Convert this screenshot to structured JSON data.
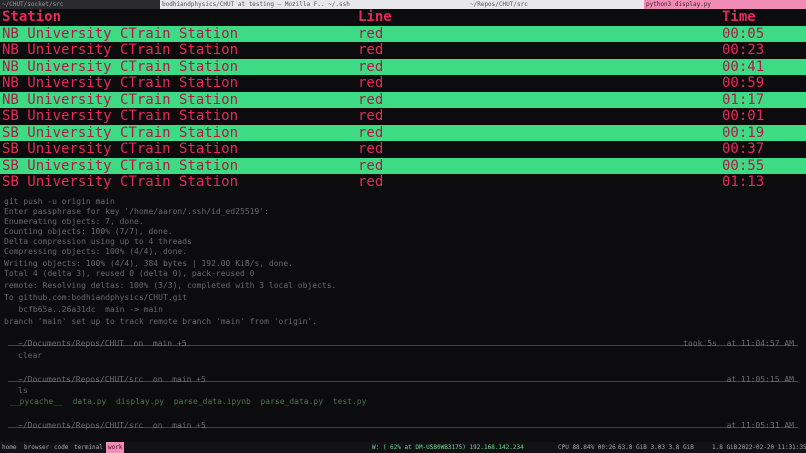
{
  "window_tabs": [
    {
      "label": "~/CHUT/socket/src"
    },
    {
      "label": "bodhiandphysics/CHUT at testing — Mozilla F..  ~/.ssh"
    },
    {
      "label": "~/Repos/CHUT/src"
    },
    {
      "label": "python3 display.py"
    }
  ],
  "terminal_bg": {
    "line1": "Enter passphrase for key '/home/aaron/.ssh/id_ed25519':",
    "line2": "Enumerating objects: 7, done.",
    "line3": "Counting objects: 100% (7/7), done.",
    "line4": "Delta compression using up to 4 threads",
    "line5": "Compressing objects: 100% (4/4), done.",
    "line6": "Writing objects: 100% (4/4), 384 bytes | 192.00 KiB/s, done.",
    "line7": "Total 4 (delta 3), reused 0 (delta 0), pack-reused 0",
    "line8": "remote: Resolving deltas: 100% (3/3), completed with 3 local objects.",
    "line9": "To github.com:bodhiandphysics/CHUT.git",
    "line10": "   bcfb65a..26a31dc  main -> main",
    "line11": "branch 'main' set up to track remote branch 'main' from 'origin'.",
    "prompt1": "~/Documents/Repos/CHUT  on  main +5",
    "prompt1_right": "took 5s  at 11:04:57 AM",
    "cmd1": "clear",
    "prompt2": "~/Documents/Repos/CHUT/src  on  main +5",
    "prompt2_right": "at 11:05:15 AM",
    "cmd2": "ls",
    "ls_out": "__pycache__  data.py  display.py  parse_data.ipynb  parse_data.py  test.py",
    "prompt3": "~/Documents/Repos/CHUT/src  on  main +5",
    "prompt3_right": "at 11:05:31 AM",
    "cmd3": "git push -u origin main"
  },
  "table": {
    "headers": {
      "station": "Station",
      "line": "Line",
      "time": "Time"
    },
    "rows": [
      {
        "station": "NB University CTrain Station",
        "line": "red",
        "time": "00:05"
      },
      {
        "station": "NB University CTrain Station",
        "line": "red",
        "time": "00:23"
      },
      {
        "station": "NB University CTrain Station",
        "line": "red",
        "time": "00:41"
      },
      {
        "station": "NB University CTrain Station",
        "line": "red",
        "time": "00:59"
      },
      {
        "station": "NB University CTrain Station",
        "line": "red",
        "time": "01:17"
      },
      {
        "station": "SB University CTrain Station",
        "line": "red",
        "time": "00:01"
      },
      {
        "station": "SB University CTrain Station",
        "line": "red",
        "time": "00:19"
      },
      {
        "station": "SB University CTrain Station",
        "line": "red",
        "time": "00:37"
      },
      {
        "station": "SB University CTrain Station",
        "line": "red",
        "time": "00:55"
      },
      {
        "station": "SB University CTrain Station",
        "line": "red",
        "time": "01:13"
      }
    ]
  },
  "statusbar": {
    "workspaces": [
      {
        "label": "home"
      },
      {
        "label": "browser"
      },
      {
        "label": "code"
      },
      {
        "label": "terminal"
      },
      {
        "label": "work"
      }
    ],
    "wifi": "W: ( 62% at DM-USB0WB3175) 192.168.142.234",
    "cpu": "CPU 88.84% 00:26",
    "mem": "63.8 GiB  3.03  3.8 GiB",
    "disk": "1.8 GiB",
    "datetime": "2022-02-20 11:31:35"
  },
  "colors": {
    "highlight_row": "#3ddc84",
    "text_red": "#e8285a",
    "active_tab": "#f08cb6"
  }
}
